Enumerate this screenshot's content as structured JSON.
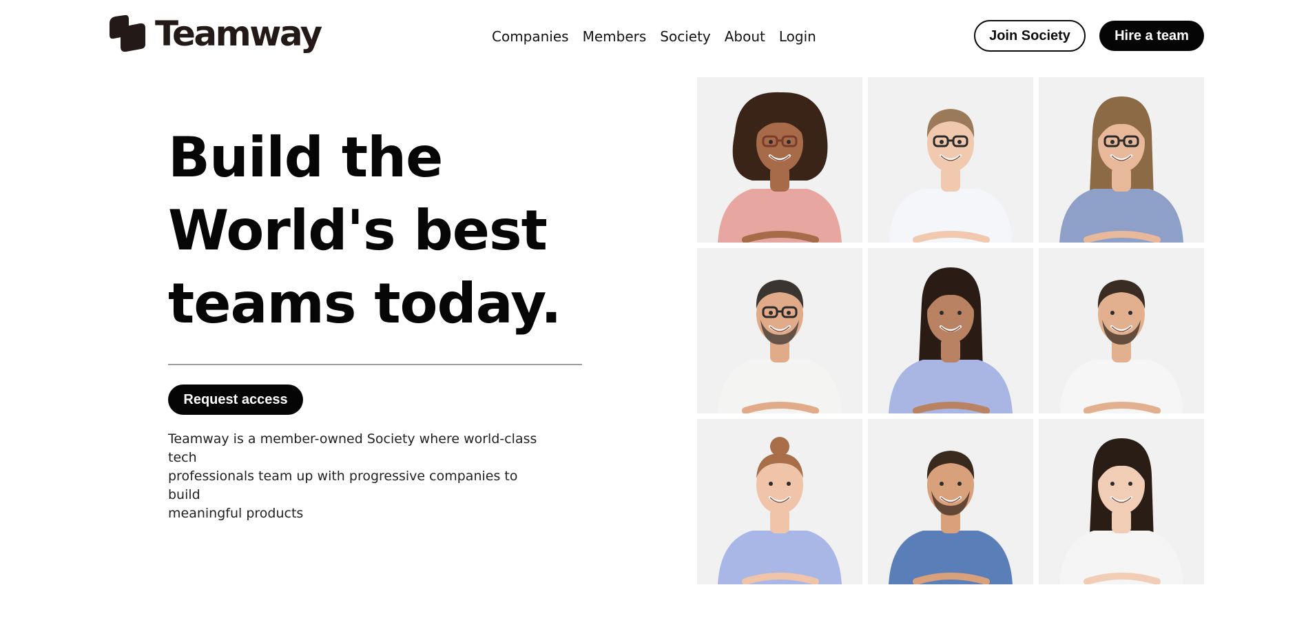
{
  "brand": {
    "name": "Teamway"
  },
  "nav": {
    "items": [
      {
        "label": "Companies"
      },
      {
        "label": "Members"
      },
      {
        "label": "Society"
      },
      {
        "label": "About"
      },
      {
        "label": "Login"
      }
    ]
  },
  "header_actions": {
    "join_label": "Join Society",
    "hire_label": "Hire a team"
  },
  "hero": {
    "title_lines": [
      "Build the",
      "World's best",
      "teams today."
    ],
    "cta_label": "Request access",
    "description_lines": [
      "Teamway is a member-owned Society where world-class tech",
      "professionals team up with progressive companies to build",
      "meaningful products"
    ]
  },
  "colors": {
    "text": "#0b0b0b",
    "logo": "#231a18",
    "button_bg": "#050505",
    "tile_bg": "#f1f1f1"
  },
  "portraits": [
    {
      "icon": "person-curly-hair-sunglasses-icon",
      "hair": "#3a2418",
      "skin": "#a86b4a",
      "shirt": "#e8a6a0"
    },
    {
      "icon": "person-glasses-white-shirt-icon",
      "hair": "#9a7a58",
      "skin": "#f0c9ae",
      "shirt": "#f4f6fa"
    },
    {
      "icon": "person-long-hair-striped-shirt-icon",
      "hair": "#8c6a45",
      "skin": "#e7b899",
      "shirt": "#8ea0c8"
    },
    {
      "icon": "person-glasses-white-tee-icon",
      "hair": "#3b3531",
      "skin": "#e1ab8a",
      "shirt": "#f4f4f2"
    },
    {
      "icon": "person-curly-hair-blue-shirt-icon",
      "hair": "#2a1c14",
      "skin": "#b98262",
      "shirt": "#a9b6e4"
    },
    {
      "icon": "person-beard-white-tee-icon",
      "hair": "#3a2c22",
      "skin": "#e3b08f",
      "shirt": "#f6f6f6"
    },
    {
      "icon": "person-bun-blue-top-icon",
      "hair": "#a86e47",
      "skin": "#efc4a8",
      "shirt": "#a9b7e6"
    },
    {
      "icon": "person-beard-blue-tee-icon",
      "hair": "#3a2a1e",
      "skin": "#d9a07c",
      "shirt": "#5a7eb8"
    },
    {
      "icon": "person-long-dark-hair-icon",
      "hair": "#2a1d16",
      "skin": "#f1cdb5",
      "shirt": "#f5f5f5"
    }
  ]
}
